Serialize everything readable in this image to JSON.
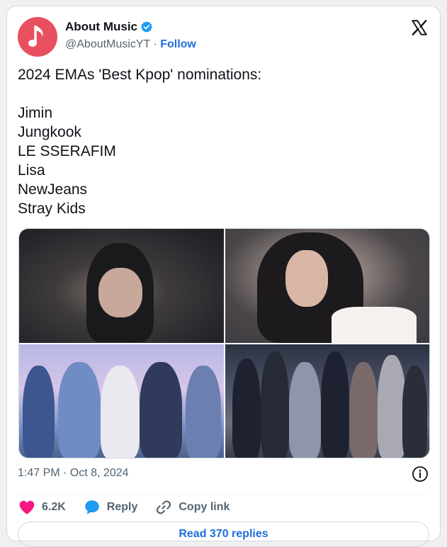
{
  "author": {
    "display_name": "About Music",
    "handle": "@AboutMusicYT",
    "separator": " · ",
    "follow_label": "Follow",
    "avatar_icon": "music-note-icon",
    "verified_icon": "verified-badge-icon",
    "avatar_color": "#e8505f"
  },
  "tweet": {
    "lines": [
      "2024 EMAs 'Best Kpop' nominations:",
      "",
      "Jimin",
      "Jungkook",
      "LE SSERAFIM",
      "Lisa",
      "NewJeans",
      "Stray Kids"
    ],
    "timestamp": "1:47 PM · Oct 8, 2024"
  },
  "actions": {
    "like_count": "6.2K",
    "reply_label": "Reply",
    "copy_link_label": "Copy link",
    "read_replies_label": "Read 370 replies"
  },
  "colors": {
    "accent": "#1d6fd9",
    "like": "#f91880",
    "muted": "#536471"
  }
}
